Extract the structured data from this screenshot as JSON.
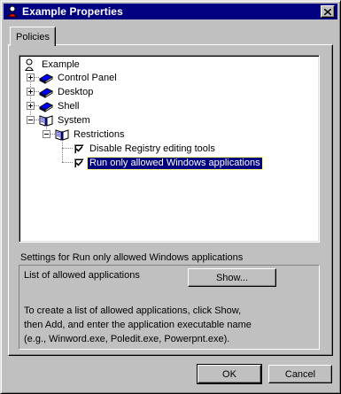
{
  "window": {
    "title": "Example Properties"
  },
  "tabs": [
    {
      "label": "Policies"
    }
  ],
  "tree": {
    "root": "Example",
    "items": [
      {
        "label": "Control Panel"
      },
      {
        "label": "Desktop"
      },
      {
        "label": "Shell"
      },
      {
        "label": "System"
      },
      {
        "label": "Restrictions"
      },
      {
        "label": "Disable Registry editing tools",
        "checked": true
      },
      {
        "label": "Run only allowed Windows applications",
        "checked": true,
        "selected": true
      }
    ]
  },
  "settings": {
    "heading": "Settings for Run only allowed Windows applications",
    "list_label": "List of allowed applications",
    "show_button": "Show...",
    "description": [
      "To create a list of allowed applications, click Show,",
      "then Add, and enter the application executable name",
      "(e.g., Winword.exe, Poledit.exe, Powerpnt.exe)."
    ]
  },
  "buttons": {
    "ok": "OK",
    "cancel": "Cancel"
  }
}
